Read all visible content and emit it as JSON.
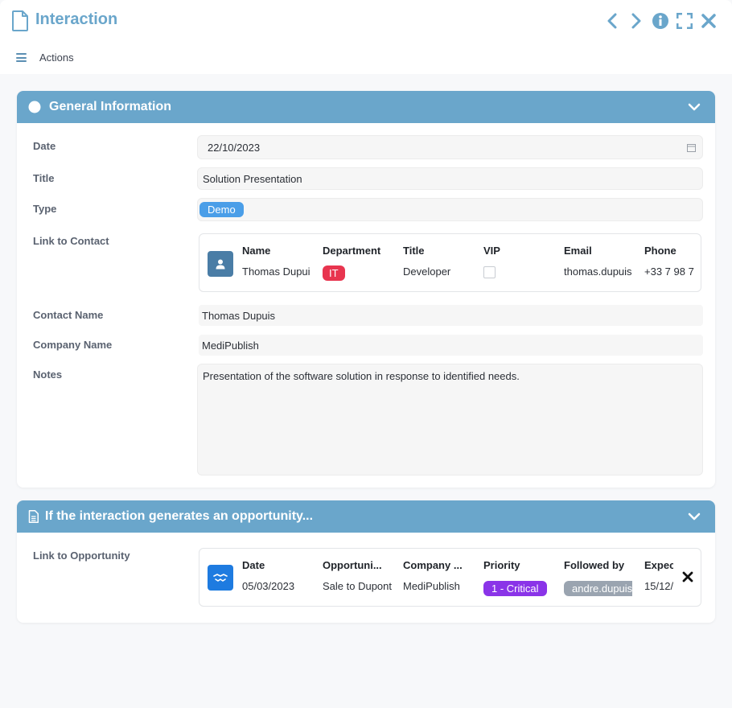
{
  "window": {
    "title": "Interaction",
    "actions_label": "Actions"
  },
  "general": {
    "header": "General Information",
    "date_label": "Date",
    "date_value": "22/10/2023",
    "title_label": "Title",
    "title_value": "Solution Presentation",
    "type_label": "Type",
    "type_value": "Demo",
    "link_contact_label": "Link to Contact",
    "contact_table": {
      "headers": [
        "Name",
        "Department",
        "Title",
        "VIP",
        "Email",
        "Phone"
      ],
      "row": {
        "name": "Thomas Dupuis",
        "department": "IT",
        "title": "Developer",
        "vip": false,
        "email": "thomas.dupuis",
        "phone": "+33 7 98 7"
      }
    },
    "contact_name_label": "Contact Name",
    "contact_name_value": "Thomas Dupuis",
    "company_name_label": "Company Name",
    "company_name_value": "MediPublish",
    "notes_label": "Notes",
    "notes_value": "Presentation of the software solution in response to identified needs."
  },
  "opportunity": {
    "header": "If the interaction generates an opportunity...",
    "link_label": "Link to Opportunity",
    "table": {
      "headers": [
        "Date",
        "Opportuni...",
        "Company ...",
        "Priority",
        "Followed by",
        "Expec"
      ],
      "row": {
        "date": "05/03/2023",
        "opportunity": "Sale to Dupont",
        "company": "MediPublish",
        "priority": "1 - Critical",
        "followed_by": "andre.dupuis",
        "expected": "15/12/"
      }
    }
  },
  "colors": {
    "accent": "#6aa6cb",
    "demo_badge": "#4a9ee8",
    "it_badge": "#e8354f",
    "critical_badge": "#8a34e8",
    "followed_badge": "#9aa4b0",
    "contact_avatar": "#4a7da6",
    "opp_avatar": "#1e7be0"
  },
  "icons": {
    "document": "document-icon",
    "prev": "chevron-left-icon",
    "next": "chevron-right-icon",
    "info": "info-icon",
    "fullscreen": "expand-icon",
    "close": "close-icon",
    "menu": "hamburger-icon",
    "circle": "circle-icon",
    "collapse": "chevron-down-icon",
    "calendar": "calendar-icon",
    "user": "user-icon",
    "handshake": "handshake-icon",
    "remove": "remove-icon"
  }
}
